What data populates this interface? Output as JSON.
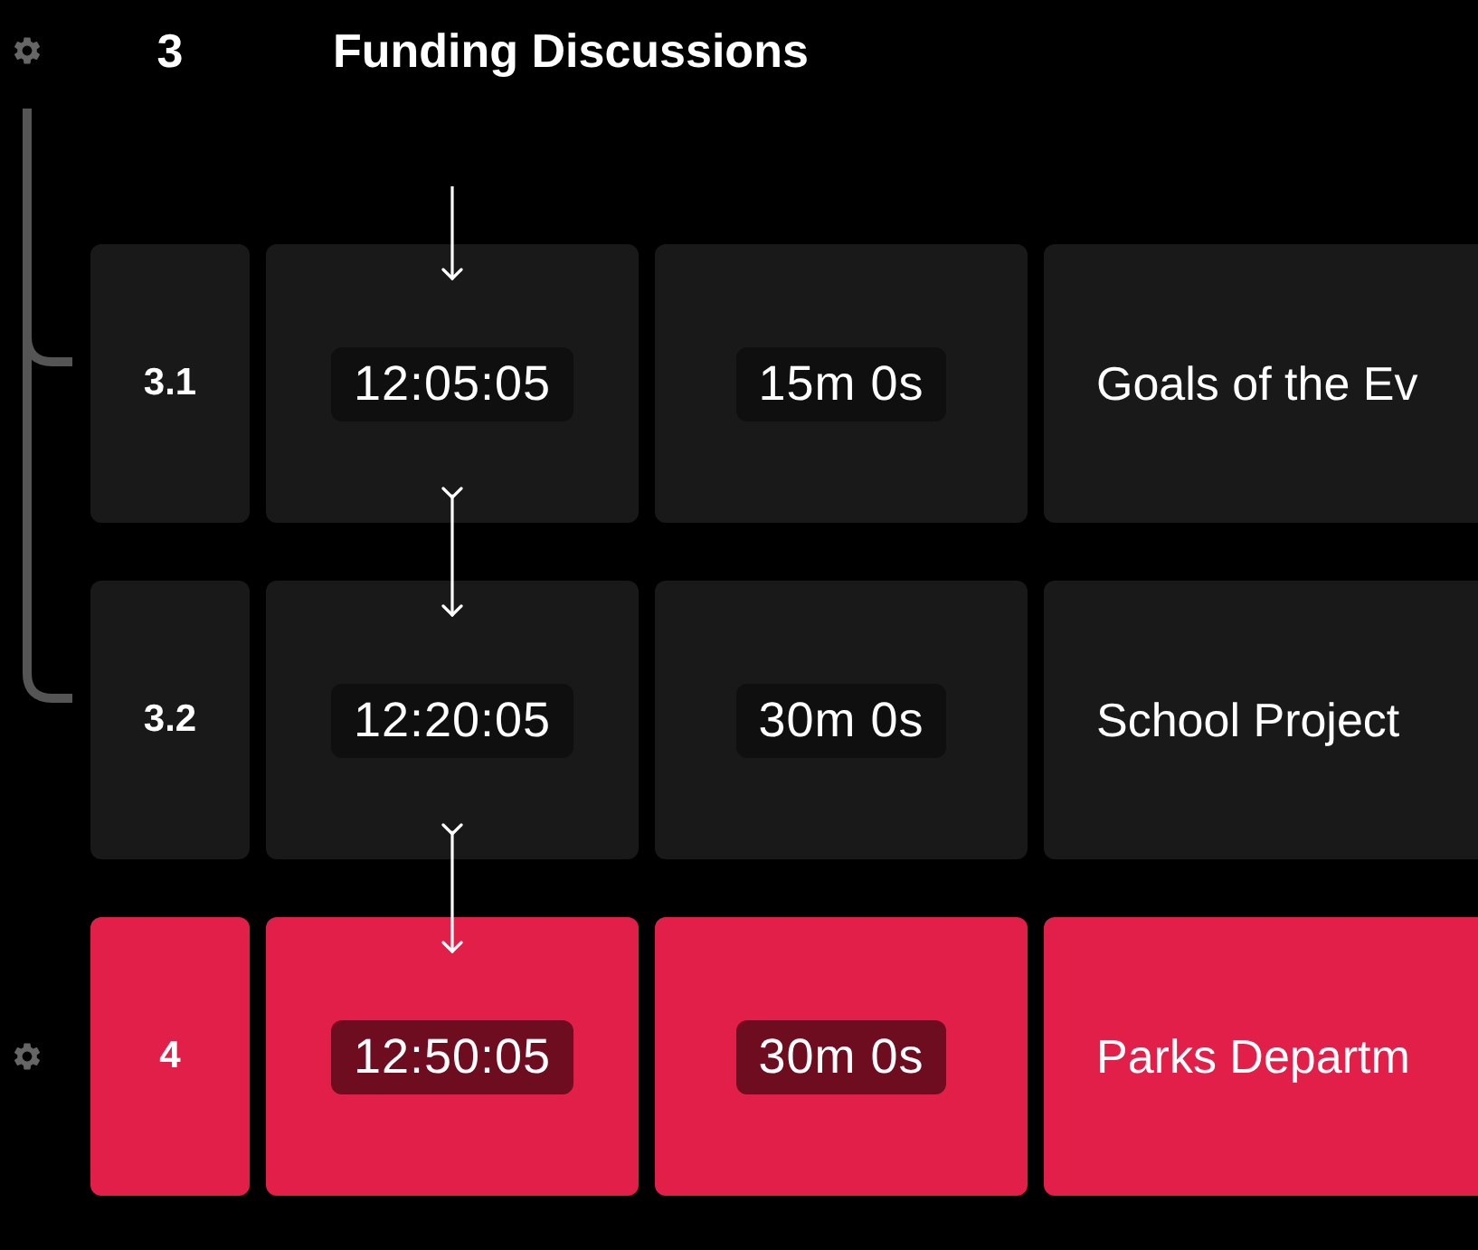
{
  "items": [
    {
      "kind": "group",
      "number": "3",
      "title": "Funding Discussions",
      "children": [
        {
          "number": "3.1",
          "start": "12:05:05",
          "duration": "15m 0s",
          "title": "Goals of the Ev",
          "selected": false
        },
        {
          "number": "3.2",
          "start": "12:20:05",
          "duration": "30m 0s",
          "title": "School Project",
          "selected": false
        }
      ]
    },
    {
      "kind": "event",
      "number": "4",
      "start": "12:50:05",
      "duration": "30m 0s",
      "title": "Parks Departm",
      "selected": true
    }
  ]
}
